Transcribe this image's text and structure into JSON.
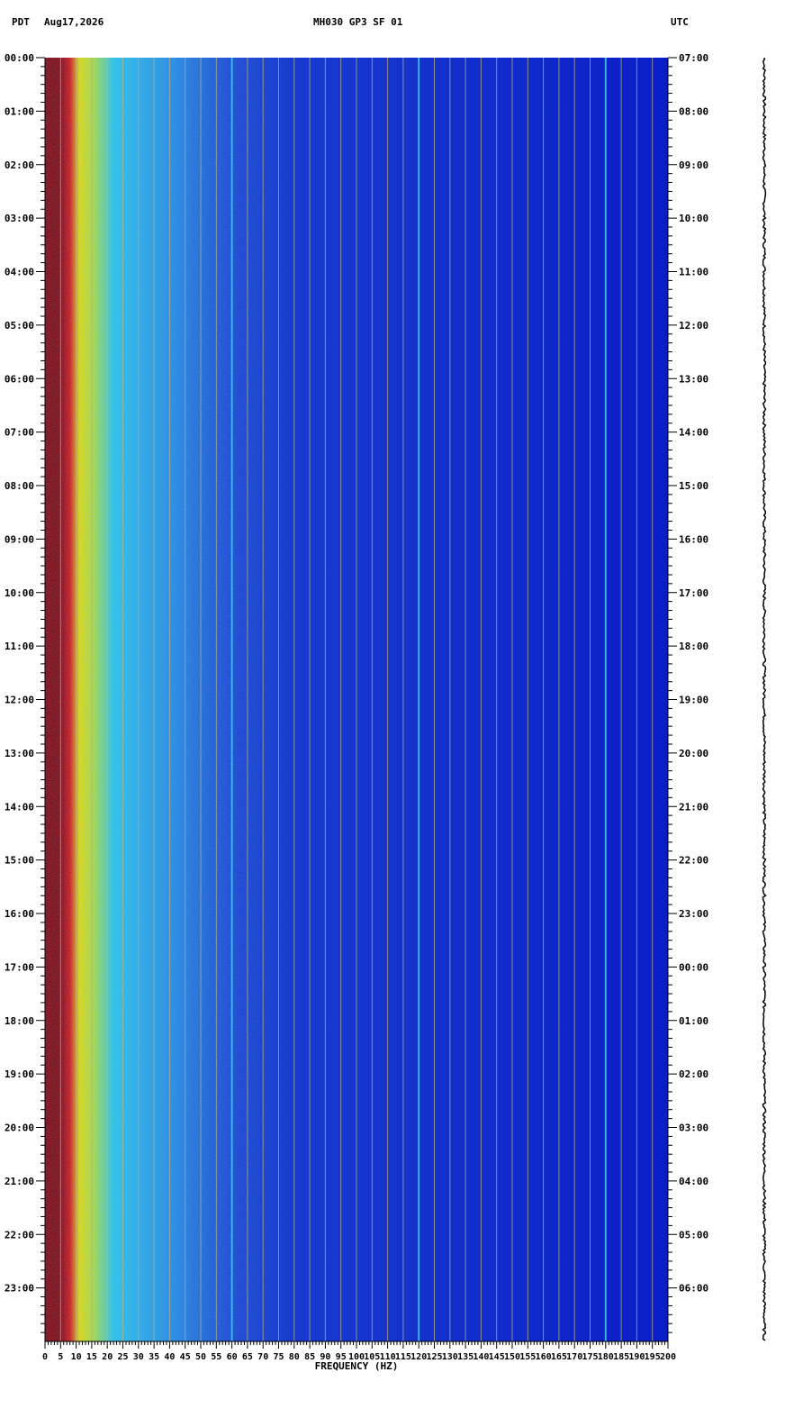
{
  "header": {
    "left_tz": "PDT",
    "date": "Aug17,2026",
    "station": "MH030 GP3 SF 01",
    "right_tz": "UTC"
  },
  "chart_data": {
    "type": "heatmap",
    "xlabel": "FREQUENCY (HZ)",
    "xlim": [
      0,
      200
    ],
    "x_ticks": [
      0,
      5,
      10,
      15,
      20,
      25,
      30,
      35,
      40,
      45,
      50,
      55,
      60,
      65,
      70,
      75,
      80,
      85,
      90,
      95,
      100,
      105,
      110,
      115,
      120,
      125,
      130,
      135,
      140,
      145,
      150,
      155,
      160,
      165,
      170,
      175,
      180,
      185,
      190,
      195,
      200
    ],
    "left_time_labels": [
      "00:00",
      "01:00",
      "02:00",
      "03:00",
      "04:00",
      "05:00",
      "06:00",
      "07:00",
      "08:00",
      "09:00",
      "10:00",
      "11:00",
      "12:00",
      "13:00",
      "14:00",
      "15:00",
      "16:00",
      "17:00",
      "18:00",
      "19:00",
      "20:00",
      "21:00",
      "22:00",
      "23:00"
    ],
    "right_time_labels": [
      "07:00",
      "08:00",
      "09:00",
      "10:00",
      "11:00",
      "12:00",
      "13:00",
      "14:00",
      "15:00",
      "16:00",
      "17:00",
      "18:00",
      "19:00",
      "20:00",
      "21:00",
      "22:00",
      "23:00",
      "00:00",
      "01:00",
      "02:00",
      "03:00",
      "04:00",
      "05:00",
      "06:00"
    ],
    "colors": {
      "background": "#0a1ec8",
      "dark_red": "#8b0000",
      "red": "#e01010",
      "yellow": "#f0e000",
      "cyan": "#30c8e8",
      "gridline": "#b8b080"
    },
    "spectral_lines_hz": [
      60,
      120,
      180
    ],
    "grid": true
  }
}
